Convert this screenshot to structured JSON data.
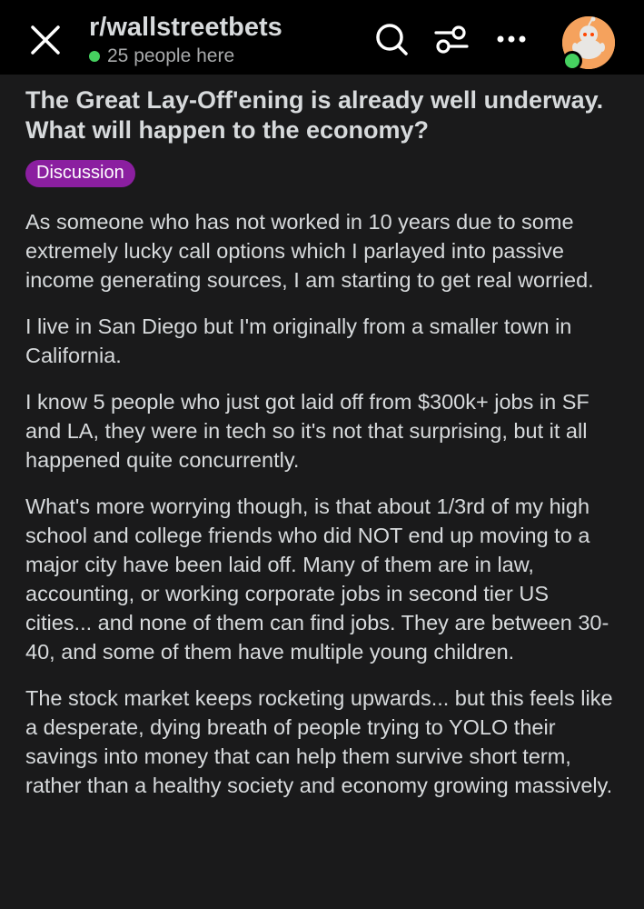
{
  "header": {
    "subreddit": "r/wallstreetbets",
    "presence": "25 people here",
    "icons": [
      "close-icon",
      "search-icon",
      "filter-icon",
      "more-icon",
      "avatar"
    ]
  },
  "post": {
    "title": "The Great Lay-Off'ening is already well underway. What will happen to the economy?",
    "flair": "Discussion",
    "paragraphs": [
      "As someone who has not worked in 10 years due to some extremely lucky call options which I parlayed into passive income generating sources, I am starting to get real worried.",
      "I live in San Diego but I'm originally from a smaller town in California.",
      "I know 5 people who just got laid off from $300k+ jobs in SF and LA, they were in tech so it's not that surprising, but it all happened quite concurrently.",
      "What's more worrying though, is that about 1/3rd of my high school and college friends who did NOT end up moving to a major city have been laid off. Many of them are in law, accounting, or working corporate jobs in second tier US cities... and none of them can find jobs. They are between 30-40, and some of them have multiple young children.",
      "The stock market keeps rocketing upwards... but this feels like a desperate, dying breath of people trying to YOLO their savings into money that can help them survive short term, rather than a healthy society and economy growing massively."
    ]
  },
  "colors": {
    "background": "#1a1a1b",
    "header": "#000000",
    "flair": "#8b1fa0",
    "online": "#46d160",
    "avatar": "#f5a25d"
  }
}
